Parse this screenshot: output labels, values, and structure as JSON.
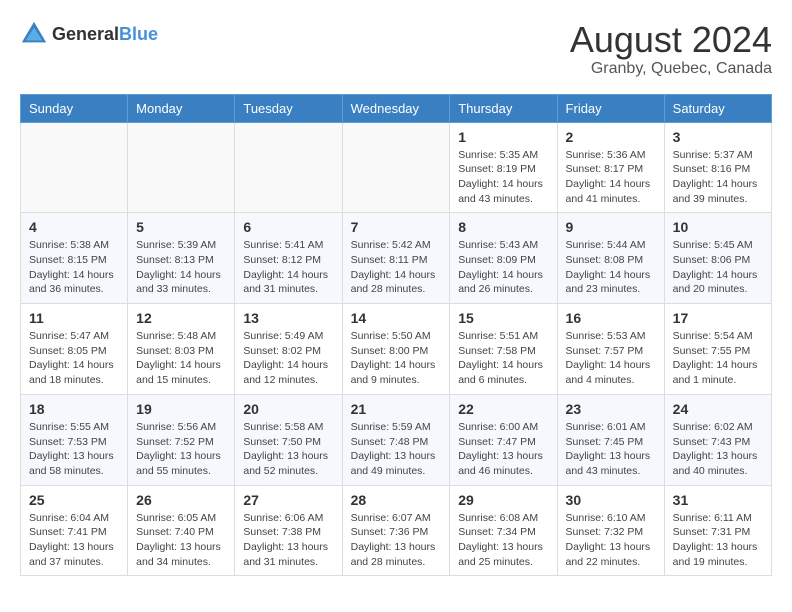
{
  "header": {
    "logo_general": "General",
    "logo_blue": "Blue",
    "month_year": "August 2024",
    "location": "Granby, Quebec, Canada"
  },
  "columns": [
    "Sunday",
    "Monday",
    "Tuesday",
    "Wednesday",
    "Thursday",
    "Friday",
    "Saturday"
  ],
  "weeks": [
    [
      {
        "day": "",
        "info": ""
      },
      {
        "day": "",
        "info": ""
      },
      {
        "day": "",
        "info": ""
      },
      {
        "day": "",
        "info": ""
      },
      {
        "day": "1",
        "info": "Sunrise: 5:35 AM\nSunset: 8:19 PM\nDaylight: 14 hours\nand 43 minutes."
      },
      {
        "day": "2",
        "info": "Sunrise: 5:36 AM\nSunset: 8:17 PM\nDaylight: 14 hours\nand 41 minutes."
      },
      {
        "day": "3",
        "info": "Sunrise: 5:37 AM\nSunset: 8:16 PM\nDaylight: 14 hours\nand 39 minutes."
      }
    ],
    [
      {
        "day": "4",
        "info": "Sunrise: 5:38 AM\nSunset: 8:15 PM\nDaylight: 14 hours\nand 36 minutes."
      },
      {
        "day": "5",
        "info": "Sunrise: 5:39 AM\nSunset: 8:13 PM\nDaylight: 14 hours\nand 33 minutes."
      },
      {
        "day": "6",
        "info": "Sunrise: 5:41 AM\nSunset: 8:12 PM\nDaylight: 14 hours\nand 31 minutes."
      },
      {
        "day": "7",
        "info": "Sunrise: 5:42 AM\nSunset: 8:11 PM\nDaylight: 14 hours\nand 28 minutes."
      },
      {
        "day": "8",
        "info": "Sunrise: 5:43 AM\nSunset: 8:09 PM\nDaylight: 14 hours\nand 26 minutes."
      },
      {
        "day": "9",
        "info": "Sunrise: 5:44 AM\nSunset: 8:08 PM\nDaylight: 14 hours\nand 23 minutes."
      },
      {
        "day": "10",
        "info": "Sunrise: 5:45 AM\nSunset: 8:06 PM\nDaylight: 14 hours\nand 20 minutes."
      }
    ],
    [
      {
        "day": "11",
        "info": "Sunrise: 5:47 AM\nSunset: 8:05 PM\nDaylight: 14 hours\nand 18 minutes."
      },
      {
        "day": "12",
        "info": "Sunrise: 5:48 AM\nSunset: 8:03 PM\nDaylight: 14 hours\nand 15 minutes."
      },
      {
        "day": "13",
        "info": "Sunrise: 5:49 AM\nSunset: 8:02 PM\nDaylight: 14 hours\nand 12 minutes."
      },
      {
        "day": "14",
        "info": "Sunrise: 5:50 AM\nSunset: 8:00 PM\nDaylight: 14 hours\nand 9 minutes."
      },
      {
        "day": "15",
        "info": "Sunrise: 5:51 AM\nSunset: 7:58 PM\nDaylight: 14 hours\nand 6 minutes."
      },
      {
        "day": "16",
        "info": "Sunrise: 5:53 AM\nSunset: 7:57 PM\nDaylight: 14 hours\nand 4 minutes."
      },
      {
        "day": "17",
        "info": "Sunrise: 5:54 AM\nSunset: 7:55 PM\nDaylight: 14 hours\nand 1 minute."
      }
    ],
    [
      {
        "day": "18",
        "info": "Sunrise: 5:55 AM\nSunset: 7:53 PM\nDaylight: 13 hours\nand 58 minutes."
      },
      {
        "day": "19",
        "info": "Sunrise: 5:56 AM\nSunset: 7:52 PM\nDaylight: 13 hours\nand 55 minutes."
      },
      {
        "day": "20",
        "info": "Sunrise: 5:58 AM\nSunset: 7:50 PM\nDaylight: 13 hours\nand 52 minutes."
      },
      {
        "day": "21",
        "info": "Sunrise: 5:59 AM\nSunset: 7:48 PM\nDaylight: 13 hours\nand 49 minutes."
      },
      {
        "day": "22",
        "info": "Sunrise: 6:00 AM\nSunset: 7:47 PM\nDaylight: 13 hours\nand 46 minutes."
      },
      {
        "day": "23",
        "info": "Sunrise: 6:01 AM\nSunset: 7:45 PM\nDaylight: 13 hours\nand 43 minutes."
      },
      {
        "day": "24",
        "info": "Sunrise: 6:02 AM\nSunset: 7:43 PM\nDaylight: 13 hours\nand 40 minutes."
      }
    ],
    [
      {
        "day": "25",
        "info": "Sunrise: 6:04 AM\nSunset: 7:41 PM\nDaylight: 13 hours\nand 37 minutes."
      },
      {
        "day": "26",
        "info": "Sunrise: 6:05 AM\nSunset: 7:40 PM\nDaylight: 13 hours\nand 34 minutes."
      },
      {
        "day": "27",
        "info": "Sunrise: 6:06 AM\nSunset: 7:38 PM\nDaylight: 13 hours\nand 31 minutes."
      },
      {
        "day": "28",
        "info": "Sunrise: 6:07 AM\nSunset: 7:36 PM\nDaylight: 13 hours\nand 28 minutes."
      },
      {
        "day": "29",
        "info": "Sunrise: 6:08 AM\nSunset: 7:34 PM\nDaylight: 13 hours\nand 25 minutes."
      },
      {
        "day": "30",
        "info": "Sunrise: 6:10 AM\nSunset: 7:32 PM\nDaylight: 13 hours\nand 22 minutes."
      },
      {
        "day": "31",
        "info": "Sunrise: 6:11 AM\nSunset: 7:31 PM\nDaylight: 13 hours\nand 19 minutes."
      }
    ]
  ]
}
